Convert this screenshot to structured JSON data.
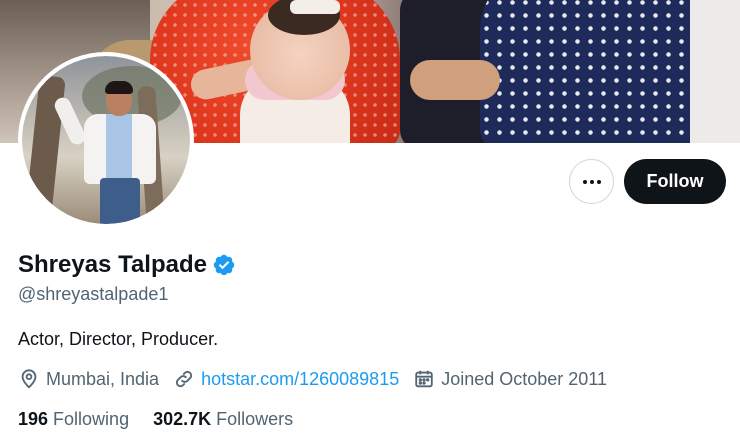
{
  "profile": {
    "display_name": "Shreyas Talpade",
    "handle": "@shreyastalpade1",
    "bio": "Actor, Director, Producer.",
    "verified_color": "#1d9bf0"
  },
  "actions": {
    "more_icon": "more-horizontal-icon",
    "follow_label": "Follow"
  },
  "meta": {
    "location": "Mumbai, India",
    "location_icon": "location-pin-icon",
    "website": "hotstar.com/1260089815",
    "website_icon": "link-icon",
    "joined": "Joined October 2011",
    "joined_icon": "calendar-icon"
  },
  "stats": {
    "following_count": "196",
    "following_label": "Following",
    "followers_count": "302.7K",
    "followers_label": "Followers"
  },
  "colors": {
    "text_primary": "#0f1419",
    "text_secondary": "#536471",
    "accent": "#1d9bf0",
    "button_dark": "#0f1419"
  }
}
